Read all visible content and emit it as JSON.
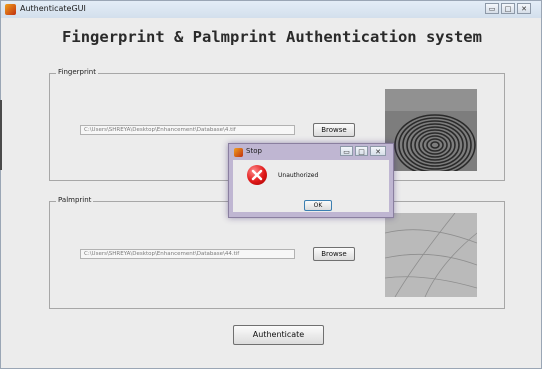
{
  "window": {
    "title": "AuthenticateGUI",
    "controls": {
      "minimize": "▭",
      "maximize": "□",
      "close": "✕"
    }
  },
  "heading": "Fingerprint & Palmprint Authentication system",
  "fingerprint": {
    "label": "Fingerprint",
    "path": "C:\\Users\\SHREYA\\Desktop\\Enhancement\\Database\\4.tif",
    "browse_label": "Browse"
  },
  "palmprint": {
    "label": "Palmprint",
    "path": "C:\\Users\\SHREYA\\Desktop\\Enhancement\\Database\\44.tif",
    "browse_label": "Browse"
  },
  "authenticate_label": "Authenticate",
  "dialog": {
    "title": "Stop",
    "message": "Unauthorized",
    "ok_label": "OK",
    "controls": {
      "minimize": "▭",
      "maximize": "□",
      "close": "✕"
    },
    "icon": "error-icon"
  },
  "colors": {
    "error": "#e01818",
    "dialog_frame": "#bfb6d2"
  }
}
